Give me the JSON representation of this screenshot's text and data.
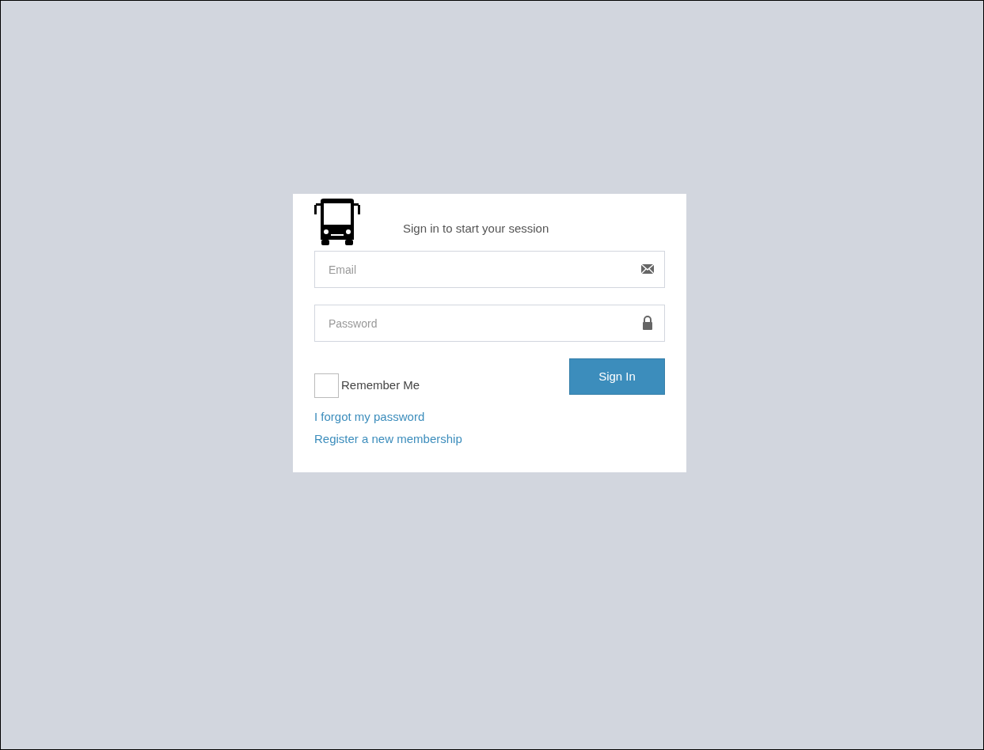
{
  "login_box": {
    "title": "Sign in to start your session",
    "email": {
      "placeholder": "Email"
    },
    "password": {
      "placeholder": "Password"
    },
    "remember_me": {
      "label": "Remember Me",
      "checked": false
    },
    "submit": {
      "label": "Sign In"
    },
    "links": [
      "I forgot my password",
      "Register a new membership"
    ]
  }
}
